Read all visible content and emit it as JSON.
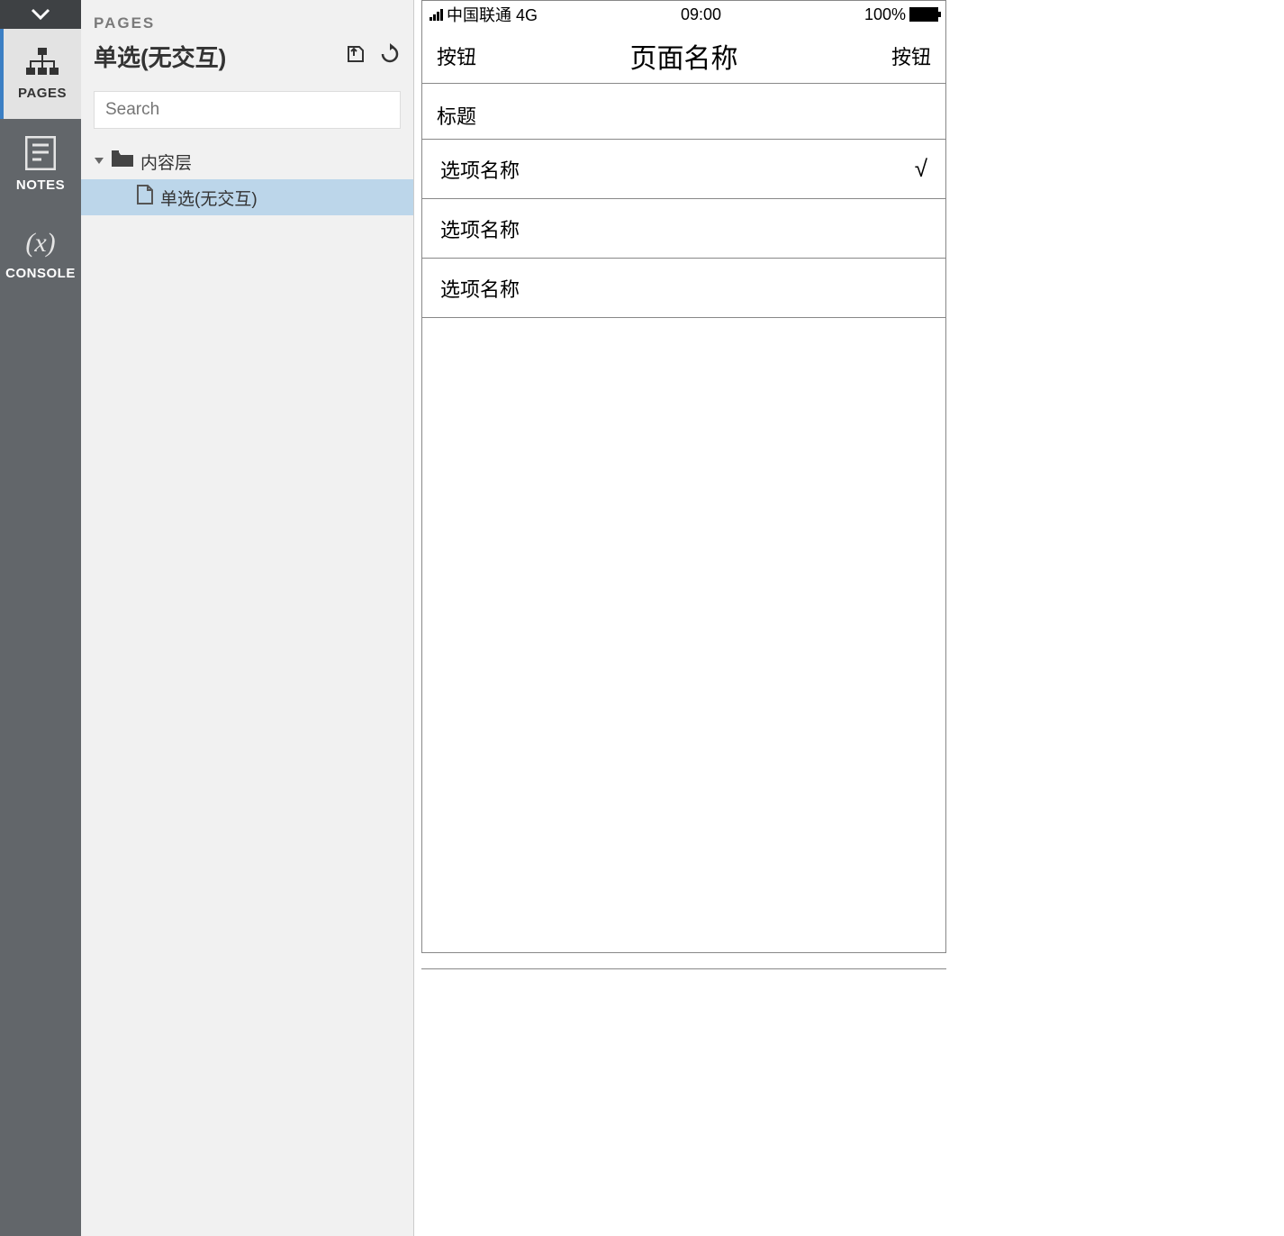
{
  "rail": {
    "pages_label": "PAGES",
    "notes_label": "NOTES",
    "console_label": "CONSOLE"
  },
  "pages_panel": {
    "header_label": "PAGES",
    "title": "单选(无交互)",
    "search_placeholder": "Search",
    "tree": {
      "folder": "内容层",
      "page": "单选(无交互)"
    }
  },
  "device": {
    "status": {
      "carrier": "中国联通 4G",
      "time": "09:00",
      "battery": "100%"
    },
    "nav": {
      "left_btn": "按钮",
      "title": "页面名称",
      "right_btn": "按钮"
    },
    "section_title": "标题",
    "options": [
      {
        "label": "选项名称",
        "checked": true
      },
      {
        "label": "选项名称",
        "checked": false
      },
      {
        "label": "选项名称",
        "checked": false
      }
    ],
    "check_glyph": "√"
  }
}
